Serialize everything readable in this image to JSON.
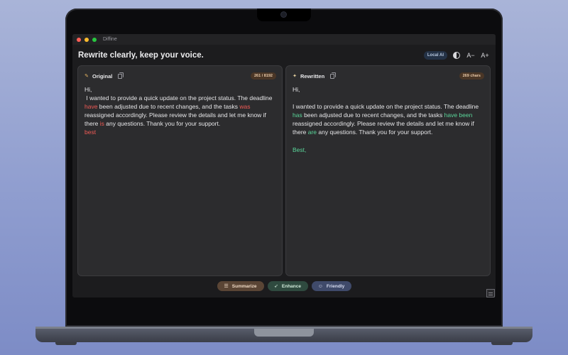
{
  "window": {
    "app_name": "Diffine"
  },
  "header": {
    "headline": "Rewrite clearly, keep your voice.",
    "local_ai_label": "Local AI",
    "font_decrease_label": "A−",
    "font_increase_label": "A+"
  },
  "original": {
    "title": "Original",
    "count": "261 / 8192",
    "segments": [
      {
        "text": "Hi,\n I wanted to provide a quick update on the project status. The deadline ",
        "type": "normal"
      },
      {
        "text": "have",
        "type": "del"
      },
      {
        "text": " been adjusted due to recent changes, and the tasks ",
        "type": "normal"
      },
      {
        "text": "was",
        "type": "del"
      },
      {
        "text": " reassigned accordingly. Please review the details and let me know if there ",
        "type": "normal"
      },
      {
        "text": "is",
        "type": "del"
      },
      {
        "text": " any questions. Thank you for your support.\n",
        "type": "normal"
      },
      {
        "text": "best",
        "type": "del"
      }
    ]
  },
  "rewritten": {
    "title": "Rewritten",
    "count": "269 chars",
    "segments": [
      {
        "text": "Hi,\n\nI wanted to provide a quick update on the project status. The deadline ",
        "type": "normal"
      },
      {
        "text": "has",
        "type": "ins"
      },
      {
        "text": " been adjusted due to recent changes, and the tasks ",
        "type": "normal"
      },
      {
        "text": "have been",
        "type": "ins"
      },
      {
        "text": " reassigned accordingly. Please review the details and let me know if there ",
        "type": "normal"
      },
      {
        "text": "are",
        "type": "ins"
      },
      {
        "text": " any questions. Thank you for your support.\n\n",
        "type": "normal"
      },
      {
        "text": "Best,",
        "type": "ins"
      }
    ]
  },
  "actions": [
    {
      "label": "Summarize",
      "icon": "lines-icon"
    },
    {
      "label": "Enhance",
      "icon": "rocket-icon"
    },
    {
      "label": "Friendly",
      "icon": "smile-icon"
    }
  ],
  "colors": {
    "deleted": "#ef5a55",
    "inserted": "#5ad69a",
    "accent_badge": "#4a3626"
  }
}
